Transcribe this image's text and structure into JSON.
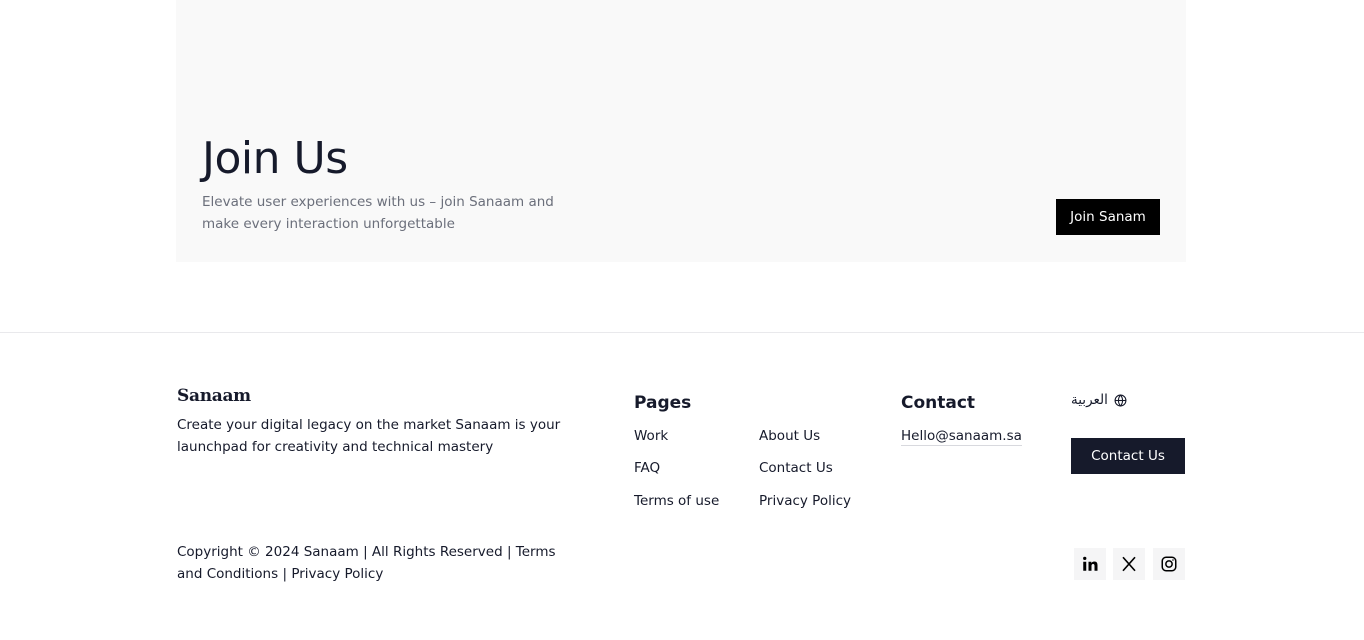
{
  "join": {
    "title": "Join Us",
    "description": "Elevate user experiences with us – join Sanaam and make every interaction unforgettable",
    "button": "Join Sanam"
  },
  "footer": {
    "brand": "Sanaam",
    "brand_description": "Create your digital legacy on the market Sanaam is your launchpad for creativity and technical mastery",
    "pages": {
      "heading": "Pages",
      "links": [
        "Work",
        "About Us",
        "FAQ",
        "Contact Us",
        "Terms of use",
        "Privacy Policy"
      ]
    },
    "contact": {
      "heading": "Contact",
      "email": "Hello@sanaam.sa"
    },
    "language": "العربية",
    "contact_button": "Contact Us",
    "copyright": {
      "text": "Copyright © 2024 Sanaam | All Rights Reserved |",
      "terms": "Terms and Conditions",
      "separator": "|",
      "privacy": "Privacy Policy"
    },
    "social": [
      "linkedin-icon",
      "x-icon",
      "instagram-icon"
    ]
  }
}
